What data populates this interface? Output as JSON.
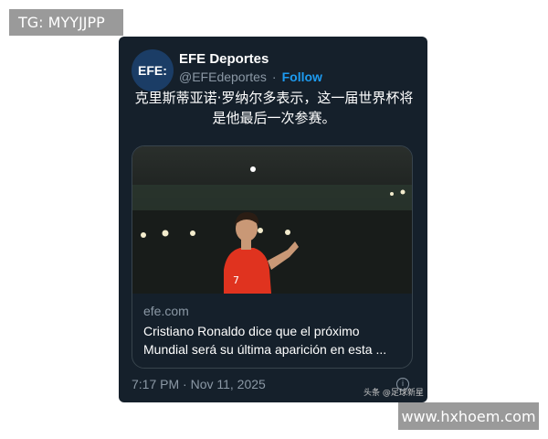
{
  "overlay": {
    "tag_label": "TG: MYYJJPP",
    "site_label": "www.hxhoem.com"
  },
  "tweet": {
    "avatar_text": "EFE:",
    "display_name": "EFE Deportes",
    "handle": "@EFEdeportes",
    "separator": "·",
    "follow_label": "Follow",
    "text": "克里斯蒂亚诺·罗纳尔多表示，这一届世界杯将是他最后一次参赛。",
    "link_card": {
      "domain": "efe.com",
      "title": "Cristiano Ronaldo dice que el próximo Mundial será su última aparición en esta ..."
    },
    "timestamp": "7:17 PM · Nov 11, 2025",
    "info_icon": "i",
    "watermark": "头条 @足球新星"
  },
  "colors": {
    "card_bg": "#15202b",
    "follow": "#1d9bf0",
    "muted": "#8b98a5",
    "jersey": "#e0331f"
  }
}
